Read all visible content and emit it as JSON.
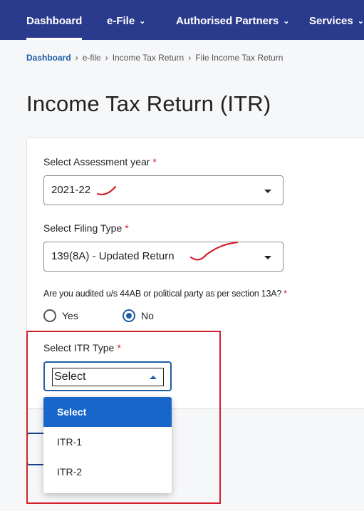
{
  "nav": {
    "items": [
      {
        "label": "Dashboard",
        "active": true,
        "dropdown": false
      },
      {
        "label": "e-File",
        "active": false,
        "dropdown": true
      },
      {
        "label": "Authorised Partners",
        "active": false,
        "dropdown": true
      },
      {
        "label": "Services",
        "active": false,
        "dropdown": true
      }
    ]
  },
  "breadcrumb": [
    "Dashboard",
    "e-file",
    "Income Tax Return",
    "File Income Tax Return"
  ],
  "page": {
    "title": "Income Tax Return (ITR)"
  },
  "form": {
    "assessment_year": {
      "label": "Select Assessment year",
      "required_mark": "*",
      "value": "2021-22"
    },
    "filing_type": {
      "label": "Select Filing Type",
      "required_mark": "*",
      "value": "139(8A) - Updated Return"
    },
    "audited": {
      "question": "Are you audited u/s 44AB or political party as per section 13A?",
      "required_mark": "*",
      "options": [
        "Yes",
        "No"
      ],
      "selected": "No"
    },
    "itr_type": {
      "label": "Select ITR Type",
      "required_mark": "*",
      "value": "Select",
      "options": [
        "Select",
        "ITR-1",
        "ITR-2"
      ]
    }
  },
  "colors": {
    "nav_bg": "#2a3a8c",
    "link_blue": "#1f5fa5",
    "selected_option_bg": "#1866c9",
    "required_red": "#d0212b",
    "annotation_red": "#d3212c"
  }
}
